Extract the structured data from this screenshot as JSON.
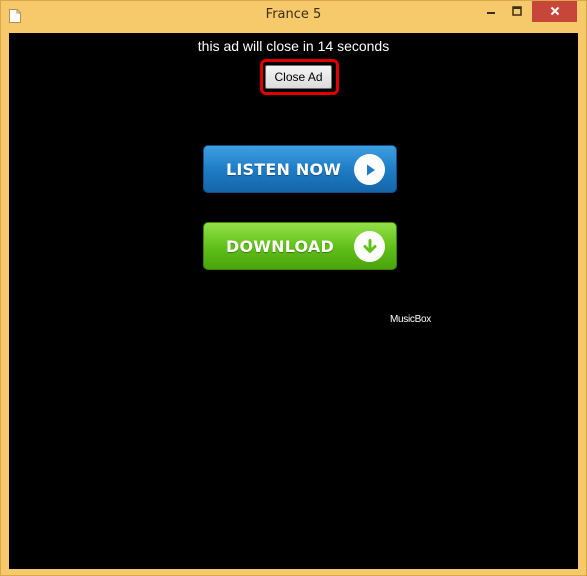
{
  "window": {
    "title": "France 5",
    "icons": {
      "app": "document-icon",
      "minimize": "minimize-icon",
      "maximize": "maximize-icon",
      "close": "close-icon"
    },
    "colors": {
      "frame": "#f6c96b",
      "close_button": "#c7463a"
    }
  },
  "ad": {
    "timer_text": "this ad will close in 14 seconds",
    "close_label": "Close Ad",
    "highlight_color": "#e00000"
  },
  "buttons": {
    "listen_label": "LISTEN NOW",
    "listen_icon": "play-icon",
    "listen_color": "#1f7dc6",
    "download_label": "DOWNLOAD",
    "download_icon": "download-arrow-icon",
    "download_color": "#62c21a"
  },
  "brand": {
    "text": "MusicBox"
  }
}
